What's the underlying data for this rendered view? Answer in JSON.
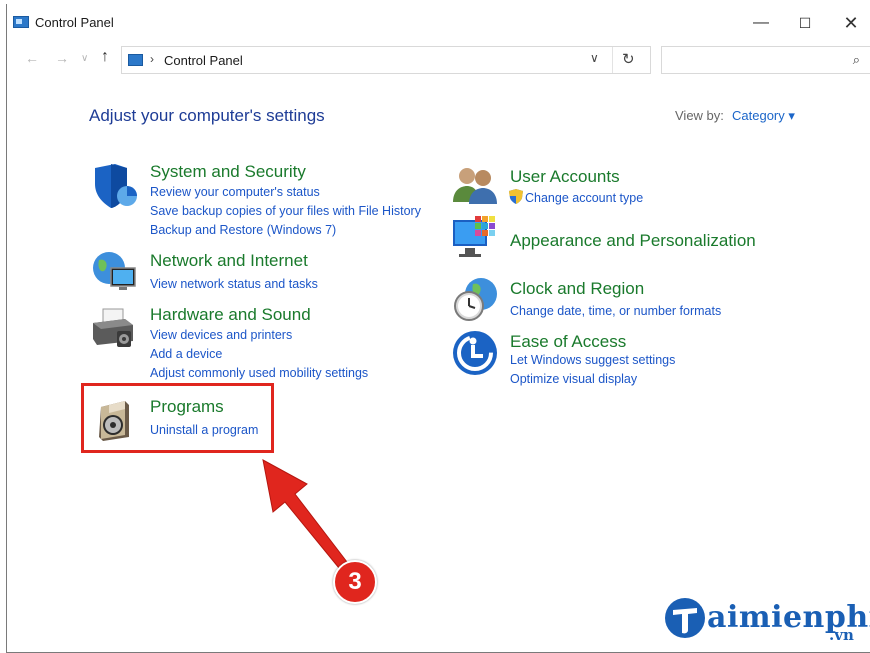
{
  "window": {
    "title": "Control Panel"
  },
  "controls": {
    "minimize": "—",
    "maximize": "☐",
    "close": "✕"
  },
  "nav": {
    "back": "←",
    "forward": "→",
    "recent": "∨",
    "up": "↑"
  },
  "address": {
    "separator": "›",
    "path": "Control Panel",
    "dropdown": "∨",
    "refresh": "↻"
  },
  "search": {
    "placeholder": "",
    "icon": "⌕"
  },
  "main": {
    "heading": "Adjust your computer's settings",
    "view_by_label": "View by:",
    "view_by_value": "Category ▾"
  },
  "categories": {
    "system_security": {
      "title": "System and Security",
      "links": [
        "Review your computer's status",
        "Save backup copies of your files with File History",
        "Backup and Restore (Windows 7)"
      ]
    },
    "network": {
      "title": "Network and Internet",
      "links": [
        "View network status and tasks"
      ]
    },
    "hardware": {
      "title": "Hardware and Sound",
      "links": [
        "View devices and printers",
        "Add a device",
        "Adjust commonly used mobility settings"
      ]
    },
    "programs": {
      "title": "Programs",
      "links": [
        "Uninstall a program"
      ]
    },
    "user_accounts": {
      "title": "User Accounts",
      "links": [
        "Change account type"
      ]
    },
    "appearance": {
      "title": "Appearance and Personalization",
      "links": []
    },
    "clock": {
      "title": "Clock and Region",
      "links": [
        "Change date, time, or number formats"
      ]
    },
    "ease": {
      "title": "Ease of Access",
      "links": [
        "Let Windows suggest settings",
        "Optimize visual display"
      ]
    }
  },
  "annotation": {
    "step": "3",
    "highlight_color": "#e0261e"
  },
  "watermark": {
    "main": "aimienphi",
    "suffix": ".vn"
  },
  "colors": {
    "heading": "#1e3c96",
    "category_title": "#1a7a2c",
    "link": "#1c56c8"
  }
}
